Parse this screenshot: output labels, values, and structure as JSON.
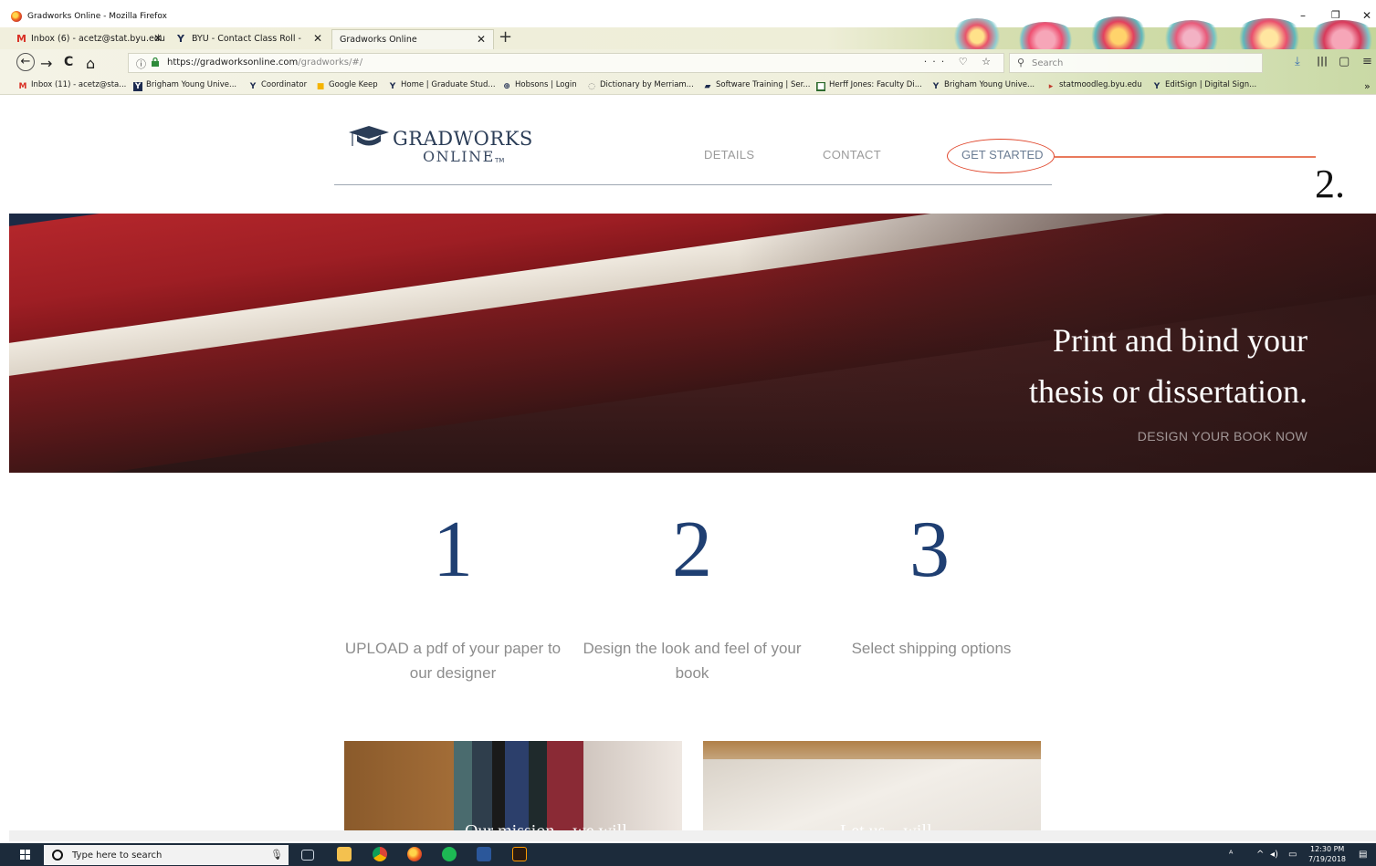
{
  "window": {
    "title": "Gradworks Online - Mozilla Firefox",
    "controls": [
      "–",
      "❐",
      "✕"
    ]
  },
  "tabs": [
    {
      "label": "Inbox (6) - acetz@stat.byu.edu",
      "icon": "gmail-icon"
    },
    {
      "label": "BYU - Contact Class Roll -",
      "icon": "byu-icon"
    },
    {
      "label": "Gradworks Online",
      "icon": "none",
      "active": true
    }
  ],
  "new_tab_label": "+",
  "toolbar": {
    "back": "←",
    "forward": "→",
    "reload": "C",
    "home": "⌂",
    "url_host": "https://gradworksonline.com",
    "url_path": "/gradworks/#/",
    "page_actions": "··· ♡ ☆",
    "search_placeholder": "Search",
    "right_tools": [
      "⤓",
      "|||",
      "▢",
      "≡"
    ]
  },
  "bookmarks": [
    {
      "label": "Inbox (11) - acetz@sta...",
      "icon": "M",
      "color": "#d93025"
    },
    {
      "label": "Brigham Young Unive...",
      "icon": "Y",
      "color": "#1d2b4f"
    },
    {
      "label": "Coordinator",
      "icon": "Y",
      "color": "#1d2b4f"
    },
    {
      "label": "Google Keep",
      "icon": "■",
      "color": "#f5b400"
    },
    {
      "label": "Home | Graduate Stud...",
      "icon": "Y",
      "color": "#1d2b4f"
    },
    {
      "label": "Hobsons | Login",
      "icon": "⊕",
      "color": "#1d2b4f"
    },
    {
      "label": "Dictionary by Merriam...",
      "icon": "◌",
      "color": "#777777"
    },
    {
      "label": "Software Training | Ser...",
      "icon": "▰",
      "color": "#1d2b4f"
    },
    {
      "label": "Herff Jones: Faculty Di...",
      "icon": "■",
      "color": "#2d6a2d"
    },
    {
      "label": "Brigham Young Unive...",
      "icon": "Y",
      "color": "#1d2b4f"
    },
    {
      "label": "statmoodleg.byu.edu",
      "icon": "▸",
      "color": "#c0392b"
    },
    {
      "label": "EditSign | Digital Sign...",
      "icon": "Y",
      "color": "#1d2b4f"
    }
  ],
  "site": {
    "logo_main": "GRADWORKS",
    "logo_sub": "ONLINE",
    "logo_tm": "TM",
    "nav": [
      "DETAILS",
      "CONTACT",
      "GET STARTED"
    ],
    "annotation_number": "2."
  },
  "hero": {
    "line1": "Print and bind your",
    "line2": "thesis or dissertation.",
    "cta": "DESIGN YOUR BOOK NOW"
  },
  "steps": [
    {
      "number": "1",
      "text": "UPLOAD a pdf of your paper to our designer"
    },
    {
      "number": "2",
      "text": "Design the look and feel of your book"
    },
    {
      "number": "3",
      "text": "Select shipping options"
    }
  ],
  "cards": [
    {
      "caption_partial": "Our mission... we will"
    },
    {
      "caption_partial": "Let us... will"
    }
  ],
  "taskbar": {
    "search_placeholder": "Type here to search",
    "apps": [
      "task-view",
      "file-explorer",
      "chrome",
      "firefox",
      "spotify",
      "word",
      "illustrator"
    ],
    "time": "12:30 PM",
    "date": "7/19/2018"
  },
  "colors": {
    "accent_blue": "#1f3f72",
    "annotation_red": "#e0452a",
    "hero_red": "#a41f25"
  }
}
